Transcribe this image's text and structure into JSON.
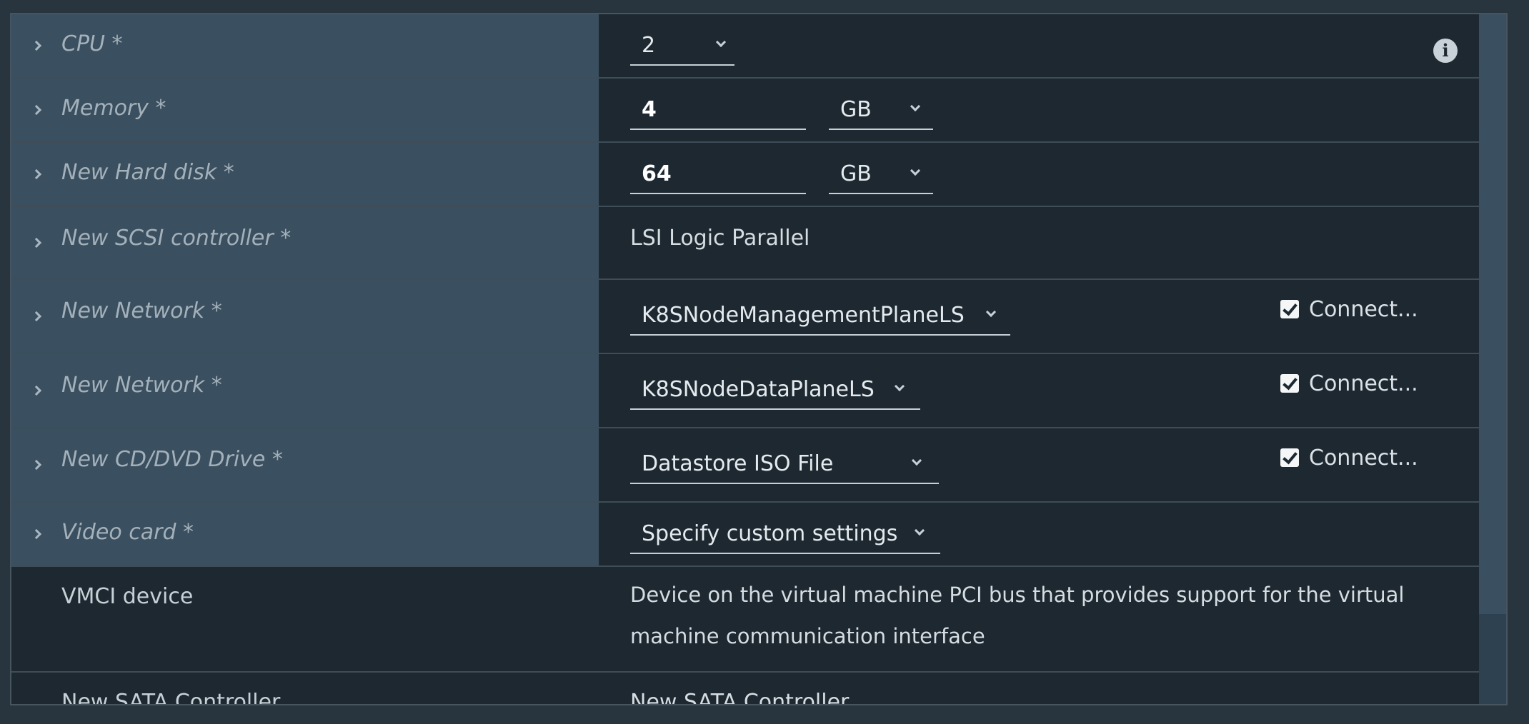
{
  "rows": {
    "cpu": {
      "label": "CPU *",
      "value": "2"
    },
    "memory": {
      "label": "Memory *",
      "value": "4",
      "unit": "GB"
    },
    "hard_disk": {
      "label": "New Hard disk *",
      "value": "64",
      "unit": "GB"
    },
    "scsi": {
      "label": "New SCSI controller *",
      "value": "LSI Logic Parallel"
    },
    "network1": {
      "label": "New Network *",
      "value": "K8SNodeManagementPlaneLS",
      "connect": "Connect..."
    },
    "network2": {
      "label": "New Network *",
      "value": "K8SNodeDataPlaneLS",
      "connect": "Connect..."
    },
    "cddvd": {
      "label": "New CD/DVD Drive *",
      "value": "Datastore ISO File",
      "connect": "Connect..."
    },
    "video": {
      "label": "Video card *",
      "value": "Specify custom settings"
    },
    "vmci": {
      "label": "VMCI device",
      "value": "Device on the virtual machine PCI bus that provides support for the virtual machine communication interface"
    },
    "sata": {
      "label": "New SATA Controller",
      "value": "New SATA Controller"
    }
  },
  "icons": {
    "info": "info-icon",
    "expand": "chevron-right-icon",
    "dropdown": "chevron-down-icon",
    "check": "checkbox-checked-icon"
  }
}
